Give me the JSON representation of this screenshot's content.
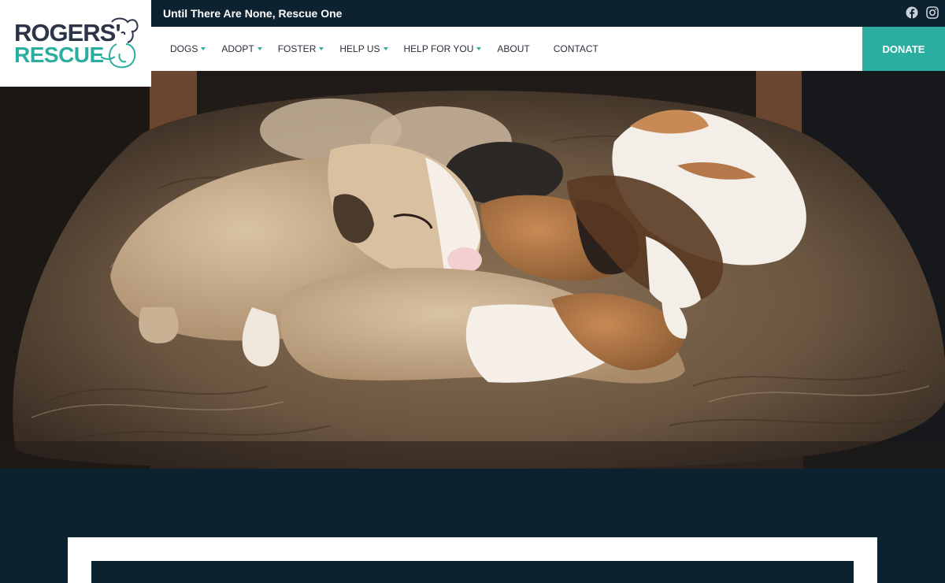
{
  "brand": {
    "logo_line1": "ROGERS'",
    "logo_line2": "RESCUE",
    "primary_color": "#0c2230",
    "accent_color": "#2bae9f"
  },
  "topbar": {
    "tagline": "Until There Are None, Rescue One",
    "social": [
      {
        "icon": "facebook-icon"
      },
      {
        "icon": "instagram-icon"
      }
    ]
  },
  "nav": {
    "items": [
      {
        "label": "DOGS",
        "has_dropdown": true
      },
      {
        "label": "ADOPT",
        "has_dropdown": true
      },
      {
        "label": "FOSTER",
        "has_dropdown": true
      },
      {
        "label": "HELP US",
        "has_dropdown": true
      },
      {
        "label": "HELP FOR YOU",
        "has_dropdown": true
      },
      {
        "label": "ABOUT",
        "has_dropdown": false
      },
      {
        "label": "CONTACT",
        "has_dropdown": false
      }
    ],
    "donate_label": "DONATE"
  },
  "hero": {
    "image": "sleeping-puppies-photo"
  }
}
